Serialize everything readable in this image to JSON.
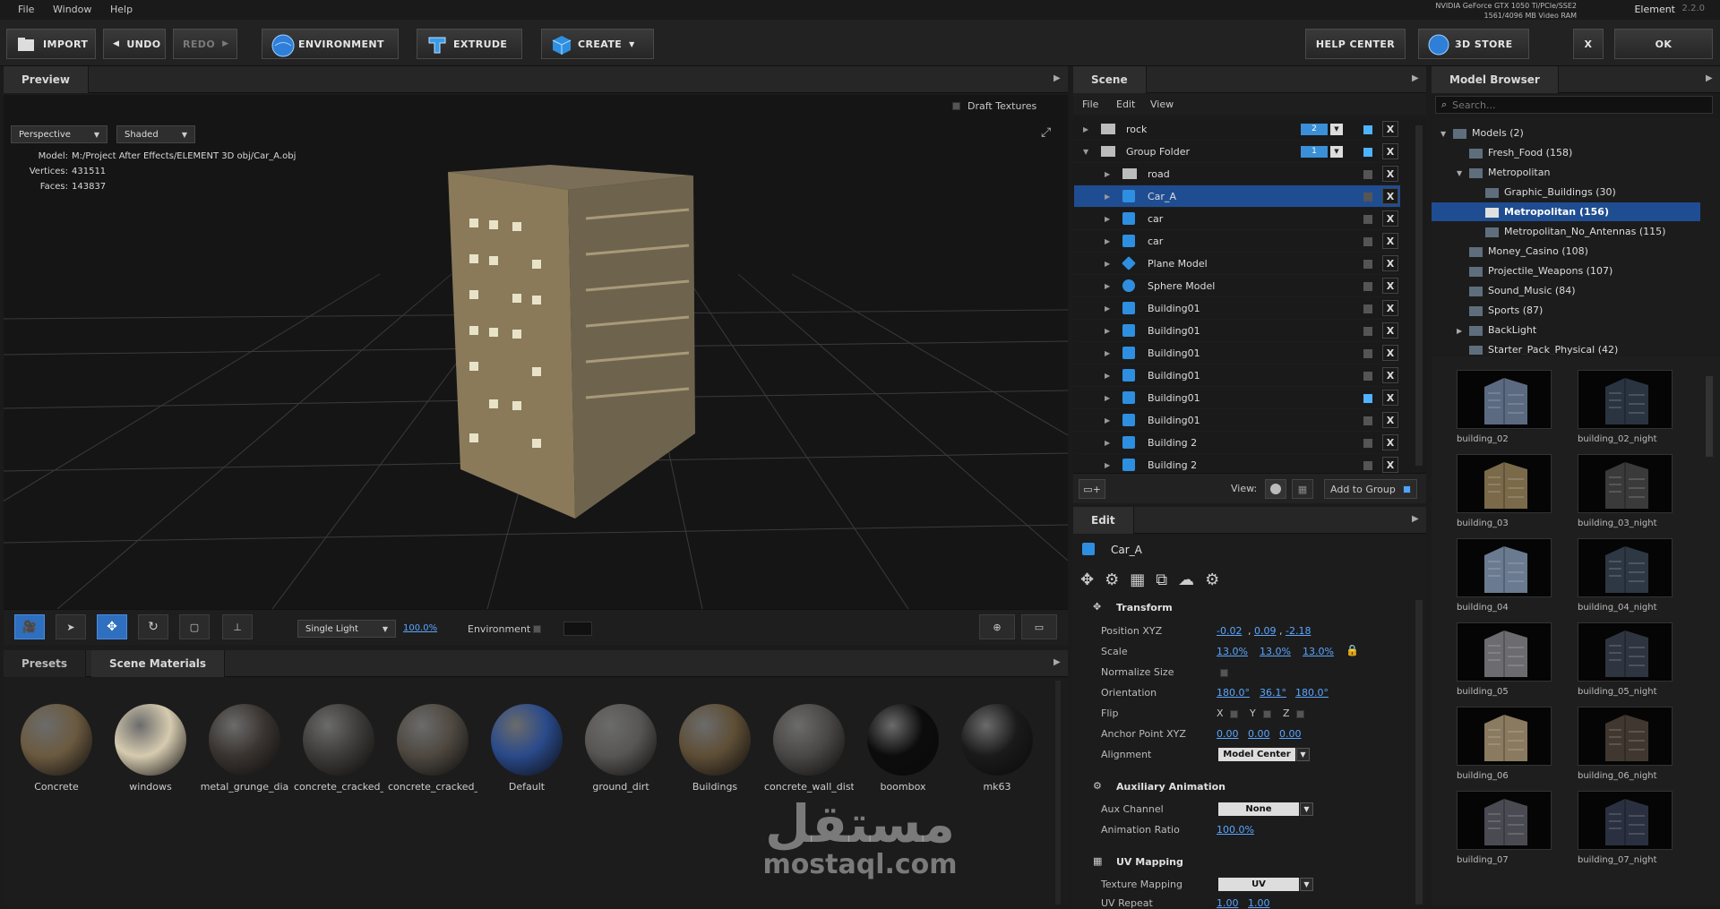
{
  "menu": {
    "file": "File",
    "window": "Window",
    "help": "Help"
  },
  "gpu": {
    "line1": "NVIDIA GeForce GTX 1050 Ti/PCIe/SSE2",
    "line2": "1561/4096 MB Video RAM"
  },
  "app": {
    "name": "Element",
    "version": "2.2.0"
  },
  "toolbar": {
    "import": "IMPORT",
    "undo": "UNDO",
    "redo": "REDO",
    "environment": "ENVIRONMENT",
    "extrude": "EXTRUDE",
    "create": "CREATE",
    "help_center": "HELP CENTER",
    "store": "3D STORE",
    "close": "X",
    "ok": "OK"
  },
  "preview": {
    "tab": "Preview",
    "draft_textures": "Draft Textures",
    "camera": "Perspective",
    "shading": "Shaded",
    "model_label": "Model:",
    "model_path": "M:/Project After Effects/ELEMENT 3D obj/Car_A.obj",
    "vertices_label": "Vertices:",
    "vertices": "431511",
    "faces_label": "Faces:",
    "faces": "143837",
    "light_mode": "Single Light",
    "light_pct": "100.0%",
    "environment_label": "Environment"
  },
  "presets": {
    "tab_presets": "Presets",
    "tab_scene_materials": "Scene Materials",
    "materials": [
      {
        "name": "Concrete",
        "color": "#6b5a40"
      },
      {
        "name": "windows",
        "color": "#d6cbb0"
      },
      {
        "name": "metal_grunge_dia",
        "color": "#3a3430"
      },
      {
        "name": "concrete_cracked_",
        "color": "#3e3c3a"
      },
      {
        "name": "concrete_cracked_",
        "color": "#4e4840"
      },
      {
        "name": "Default",
        "color": "#2a4a8a"
      },
      {
        "name": "ground_dirt",
        "color": "#585654"
      },
      {
        "name": "Buildings",
        "color": "#5e4e36"
      },
      {
        "name": "concrete_wall_dist",
        "color": "#4a4846"
      },
      {
        "name": "boombox",
        "color": "#0c0c0c"
      },
      {
        "name": "mk63",
        "color": "#1a1a1a"
      }
    ]
  },
  "watermark": {
    "arabic": "مستقل",
    "latin": "mostaql.com"
  },
  "scene": {
    "tab": "Scene",
    "menu": {
      "file": "File",
      "edit": "Edit",
      "view": "View"
    },
    "rows": [
      {
        "label": "rock",
        "kind": "folder",
        "num": "2",
        "vis_on": true,
        "sel": false,
        "indent": 0
      },
      {
        "label": "Group Folder",
        "kind": "folder",
        "num": "1",
        "vis_on": true,
        "sel": false,
        "indent": 0
      },
      {
        "label": "road",
        "kind": "folder",
        "vis_on": false,
        "sel": false,
        "indent": 1
      },
      {
        "label": "Car_A",
        "kind": "cube",
        "vis_on": false,
        "sel": true,
        "indent": 1
      },
      {
        "label": "car",
        "kind": "cube",
        "vis_on": false,
        "sel": false,
        "indent": 1
      },
      {
        "label": "car",
        "kind": "cube",
        "vis_on": false,
        "sel": false,
        "indent": 1
      },
      {
        "label": "Plane Model",
        "kind": "plane",
        "vis_on": false,
        "sel": false,
        "indent": 1
      },
      {
        "label": "Sphere Model",
        "kind": "sphere",
        "vis_on": false,
        "sel": false,
        "indent": 1
      },
      {
        "label": "Building01",
        "kind": "cube",
        "vis_on": false,
        "sel": false,
        "indent": 1
      },
      {
        "label": "Building01",
        "kind": "cube",
        "vis_on": false,
        "sel": false,
        "indent": 1
      },
      {
        "label": "Building01",
        "kind": "cube",
        "vis_on": false,
        "sel": false,
        "indent": 1
      },
      {
        "label": "Building01",
        "kind": "cube",
        "vis_on": false,
        "sel": false,
        "indent": 1
      },
      {
        "label": "Building01",
        "kind": "cube",
        "vis_on": true,
        "sel": false,
        "indent": 1
      },
      {
        "label": "Building01",
        "kind": "cube",
        "vis_on": false,
        "sel": false,
        "indent": 1
      },
      {
        "label": "Building 2",
        "kind": "cube",
        "vis_on": false,
        "sel": false,
        "indent": 1
      },
      {
        "label": "Building 2",
        "kind": "cube",
        "vis_on": false,
        "sel": false,
        "indent": 1
      }
    ],
    "view_label": "View:",
    "add_to_group": "Add to Group"
  },
  "edit": {
    "tab": "Edit",
    "object_name": "Car_A",
    "transform_title": "Transform",
    "position_label": "Position XYZ",
    "position": [
      "-0.02",
      "0.09",
      "-2.18"
    ],
    "scale_label": "Scale",
    "scale": [
      "13.0%",
      "13.0%",
      "13.0%"
    ],
    "normalize_label": "Normalize Size",
    "orientation_label": "Orientation",
    "orientation": [
      "180.0°",
      "36.1°",
      "180.0°"
    ],
    "flip_label": "Flip",
    "flip_axes": [
      "X",
      "Y",
      "Z"
    ],
    "anchor_label": "Anchor Point XYZ",
    "anchor": [
      "0.00",
      "0.00",
      "0.00"
    ],
    "alignment_label": "Alignment",
    "alignment": "Model Center",
    "aux_title": "Auxiliary Animation",
    "aux_channel_label": "Aux Channel",
    "aux_channel": "None",
    "anim_ratio_label": "Animation Ratio",
    "anim_ratio": "100.0%",
    "uv_title": "UV Mapping",
    "texture_mapping_label": "Texture Mapping",
    "texture_mapping": "UV",
    "uv_repeat_label": "UV Repeat",
    "uv_repeat": [
      "1.00",
      "1.00"
    ]
  },
  "browser": {
    "tab": "Model Browser",
    "search_placeholder": "Search...",
    "tree": [
      {
        "label": "Models (2)",
        "indent": 0,
        "arrow": "▼",
        "sel": false
      },
      {
        "label": "Fresh_Food (158)",
        "indent": 1,
        "arrow": "",
        "sel": false
      },
      {
        "label": "Metropolitan",
        "indent": 1,
        "arrow": "▼",
        "sel": false
      },
      {
        "label": "Graphic_Buildings (30)",
        "indent": 2,
        "arrow": "",
        "sel": false
      },
      {
        "label": "Metropolitan (156)",
        "indent": 2,
        "arrow": "",
        "sel": true
      },
      {
        "label": "Metropolitan_No_Antennas (115)",
        "indent": 2,
        "arrow": "",
        "sel": false
      },
      {
        "label": "Money_Casino (108)",
        "indent": 1,
        "arrow": "",
        "sel": false
      },
      {
        "label": "Projectile_Weapons (107)",
        "indent": 1,
        "arrow": "",
        "sel": false
      },
      {
        "label": "Sound_Music (84)",
        "indent": 1,
        "arrow": "",
        "sel": false
      },
      {
        "label": "Sports (87)",
        "indent": 1,
        "arrow": "",
        "sel": false
      },
      {
        "label": "BackLight",
        "indent": 1,
        "arrow": "▶",
        "sel": false
      },
      {
        "label": "Starter_Pack_Physical (42)",
        "indent": 1,
        "arrow": "",
        "sel": false
      }
    ],
    "thumbs": [
      {
        "name": "building_02",
        "color": "#5b6a80"
      },
      {
        "name": "building_02_night",
        "color": "#2a3340"
      },
      {
        "name": "building_03",
        "color": "#7a6a4a"
      },
      {
        "name": "building_03_night",
        "color": "#3a3a3a"
      },
      {
        "name": "building_04",
        "color": "#6a7a90"
      },
      {
        "name": "building_04_night",
        "color": "#2e3844"
      },
      {
        "name": "building_05",
        "color": "#6c6c70"
      },
      {
        "name": "building_05_night",
        "color": "#2e3440"
      },
      {
        "name": "building_06",
        "color": "#8a7a60"
      },
      {
        "name": "building_06_night",
        "color": "#403830"
      },
      {
        "name": "building_07",
        "color": "#4a4a52"
      },
      {
        "name": "building_07_night",
        "color": "#2a3040"
      }
    ]
  }
}
